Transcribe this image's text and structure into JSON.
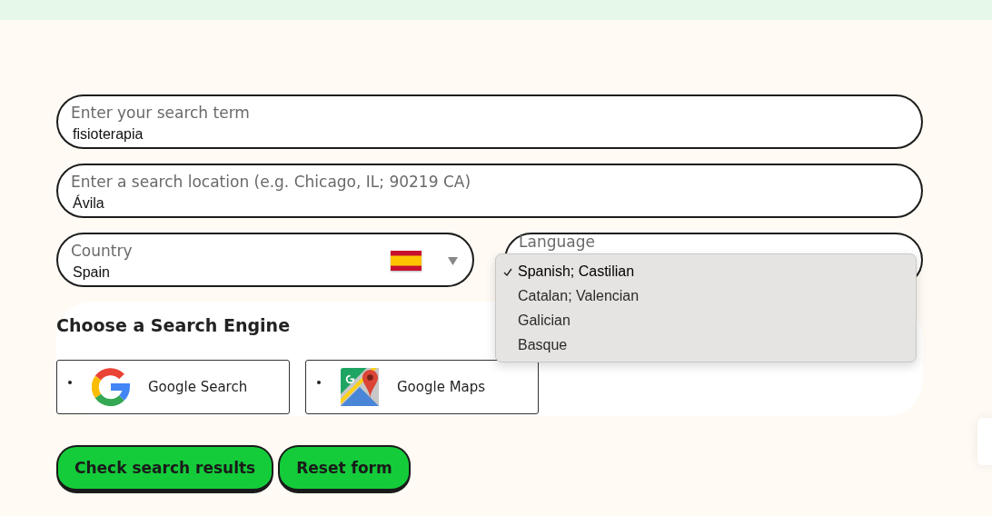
{
  "search_term": {
    "label": "Enter your search term",
    "value": "fisioterapia"
  },
  "location": {
    "label": "Enter a search location (e.g. Chicago, IL; 90219 CA)",
    "value": "Ávila"
  },
  "country": {
    "label": "Country",
    "value": "Spain"
  },
  "language": {
    "label": "Language",
    "options": [
      {
        "label": "Spanish; Castilian",
        "selected": true
      },
      {
        "label": "Catalan; Valencian",
        "selected": false
      },
      {
        "label": "Galician",
        "selected": false
      },
      {
        "label": "Basque",
        "selected": false
      }
    ]
  },
  "engine_section": {
    "title": "Choose a Search Engine",
    "engines": [
      {
        "kind": "google-search",
        "label": "Google Search"
      },
      {
        "kind": "google-maps",
        "label": "Google Maps"
      }
    ]
  },
  "buttons": [
    {
      "label": "Check search results"
    },
    {
      "label": "Reset form"
    }
  ]
}
